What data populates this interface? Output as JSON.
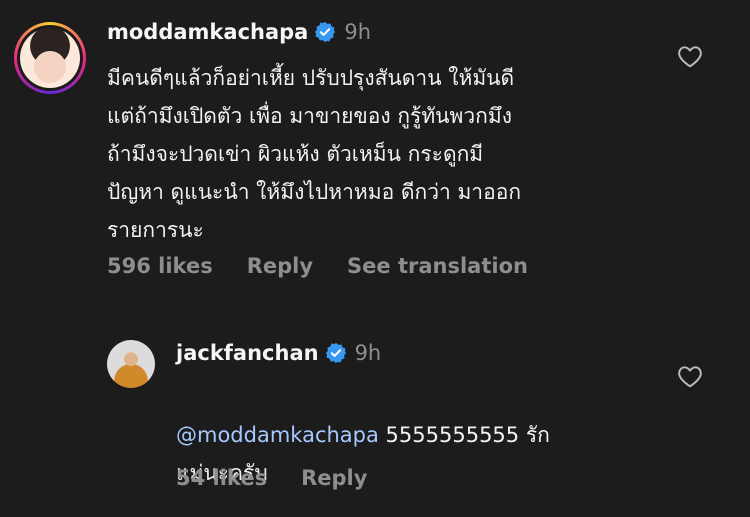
{
  "comments": [
    {
      "username": "moddamkachapa",
      "time": "9h",
      "text": "มีคนดีๆแล้วก็อย่าเหี้ย ปรับปรุงสันดาน ให้มันดี\nแต่ถ้ามึงเปิดตัว เพื่อ มาขายของ กูรู้ทันพวกมึง\nถ้ามึงจะปวดเข่า ผิวแห้ง ตัวเหม็น กระดูกมี\nปัญหา ดูแนะนำ ให้มึงไปหาหมอ ดีกว่า มาออก\nรายการนะ",
      "likes": "596 likes",
      "reply_label": "Reply",
      "translate_label": "See translation"
    }
  ],
  "reply": {
    "username": "jackfanchan",
    "time": "9h",
    "mention": "@moddamkachapa",
    "text_line1": " 5555555555 รัก",
    "text_line2": "แม่นะครับ",
    "likes": "54 likes",
    "reply_label": "Reply"
  },
  "colors": {
    "background": "#1c1c1c",
    "verified": "#3897f0",
    "mention": "#a6c8ff",
    "muted": "#8e8e8e"
  },
  "icons": [
    "verified-badge-icon",
    "heart-icon"
  ]
}
